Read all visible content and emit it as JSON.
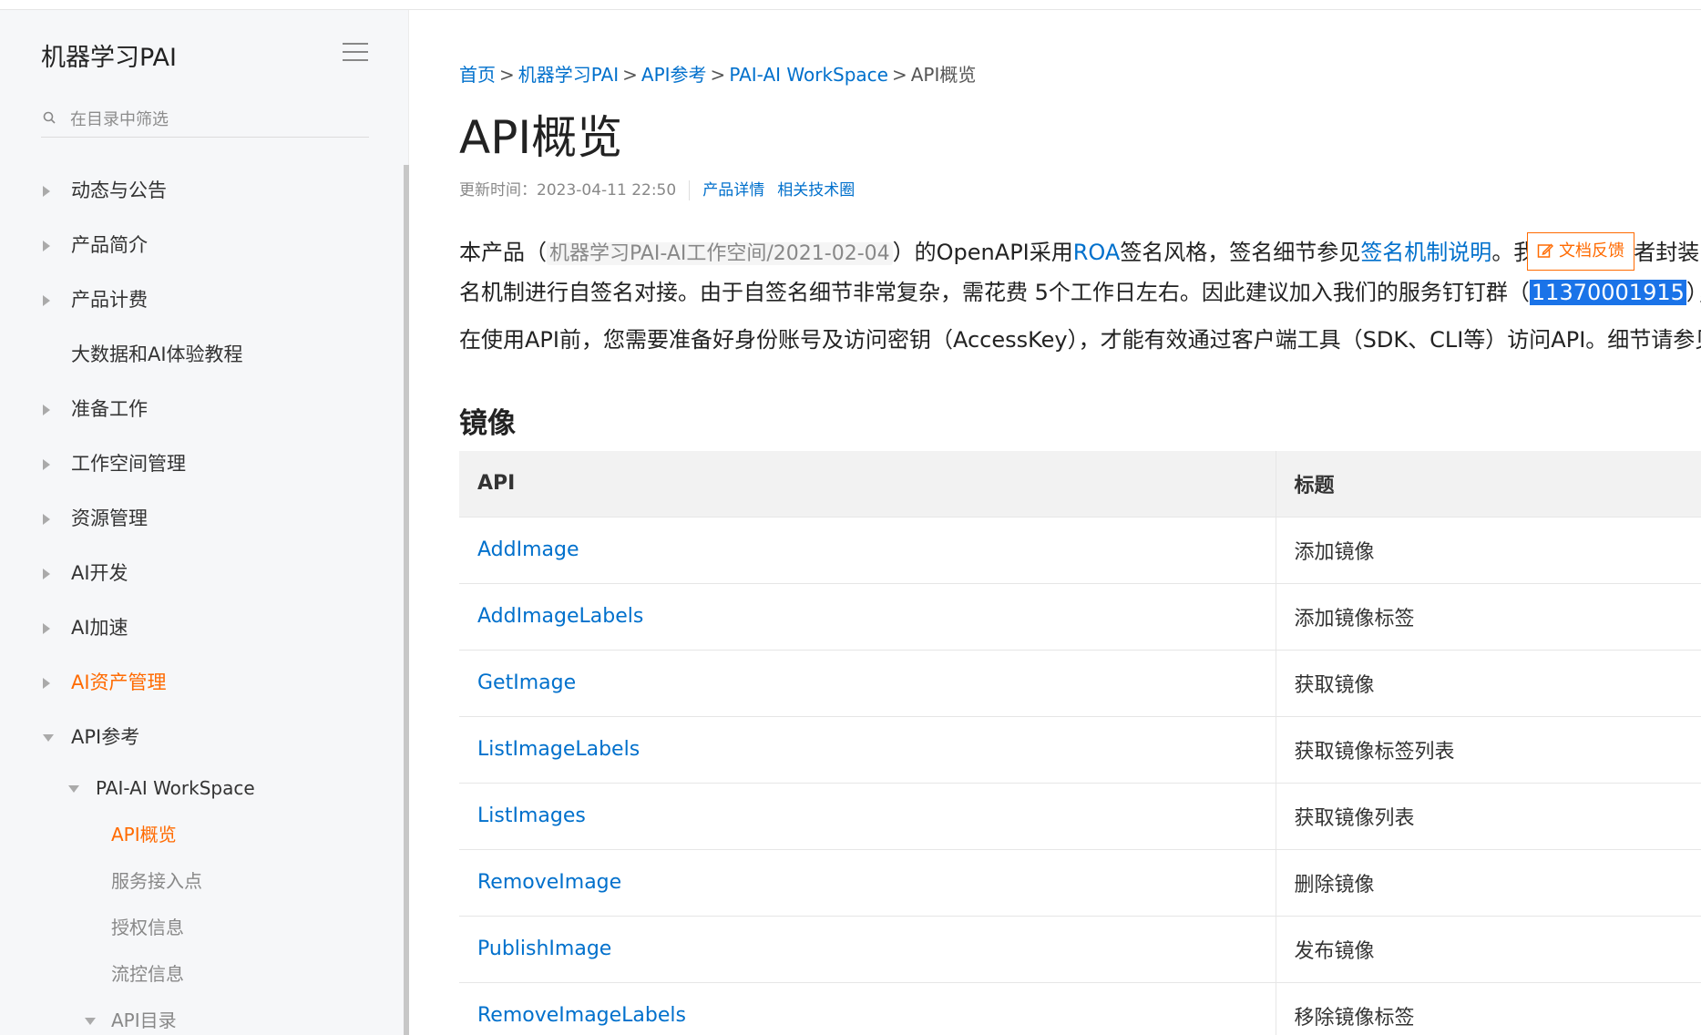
{
  "sidebar": {
    "title": "机器学习PAI",
    "search_placeholder": "在目录中筛选",
    "items": [
      {
        "label": "动态与公告"
      },
      {
        "label": "产品简介"
      },
      {
        "label": "产品计费"
      },
      {
        "label": "大数据和AI体验教程"
      },
      {
        "label": "准备工作"
      },
      {
        "label": "工作空间管理"
      },
      {
        "label": "资源管理"
      },
      {
        "label": "AI开发"
      },
      {
        "label": "AI加速"
      },
      {
        "label": "AI资产管理"
      },
      {
        "label": "API参考"
      },
      {
        "label": "PAI-AI WorkSpace"
      },
      {
        "label": "API概览"
      },
      {
        "label": "服务接入点"
      },
      {
        "label": "授权信息"
      },
      {
        "label": "流控信息"
      },
      {
        "label": "API目录"
      }
    ]
  },
  "breadcrumb": {
    "items": [
      "首页",
      "机器学习PAI",
      "API参考",
      "PAI-AI WorkSpace"
    ],
    "separator": ">",
    "current": "API概览"
  },
  "page": {
    "title": "API概览",
    "updated": "更新时间：2023-04-11 22:50",
    "links": [
      "产品详情",
      "相关技术圈"
    ]
  },
  "content": {
    "p1": {
      "t1": "本产品（",
      "code": "机器学习PAI-AI工作空间/2021-02-04",
      "t2": "）的OpenAPI采用",
      "link1": "ROA",
      "t3": "签名风格，签名细节参见",
      "link2": "签名机制说明",
      "t4": "。我们",
      "t5": "或者封装"
    },
    "p2": {
      "t1": "名机制进行自签名对接。由于自签名细节非常复杂，需花费 5个工作日左右。因此建议加入我们的服务钉钉群（",
      "hl": "11370001915",
      "t2": "），"
    },
    "p3": "在使用API前，您需要准备好身份账号及访问密钥（AccessKey），才能有效通过客户端工具（SDK、CLI等）访问API。细节请参见",
    "feedback": "文档反馈",
    "section": "镜像"
  },
  "table": {
    "headers": [
      "API",
      "标题"
    ],
    "rows": [
      {
        "api": "AddImage",
        "title": "添加镜像"
      },
      {
        "api": "AddImageLabels",
        "title": "添加镜像标签"
      },
      {
        "api": "GetImage",
        "title": "获取镜像"
      },
      {
        "api": "ListImageLabels",
        "title": "获取镜像标签列表"
      },
      {
        "api": "ListImages",
        "title": "获取镜像列表"
      },
      {
        "api": "RemoveImage",
        "title": "删除镜像"
      },
      {
        "api": "PublishImage",
        "title": "发布镜像"
      },
      {
        "api": "RemoveImageLabels",
        "title": "移除镜像标签"
      }
    ]
  },
  "colors": {
    "link": "#0070cc",
    "accent": "#ff6a00",
    "selection": "#1a73e8"
  }
}
